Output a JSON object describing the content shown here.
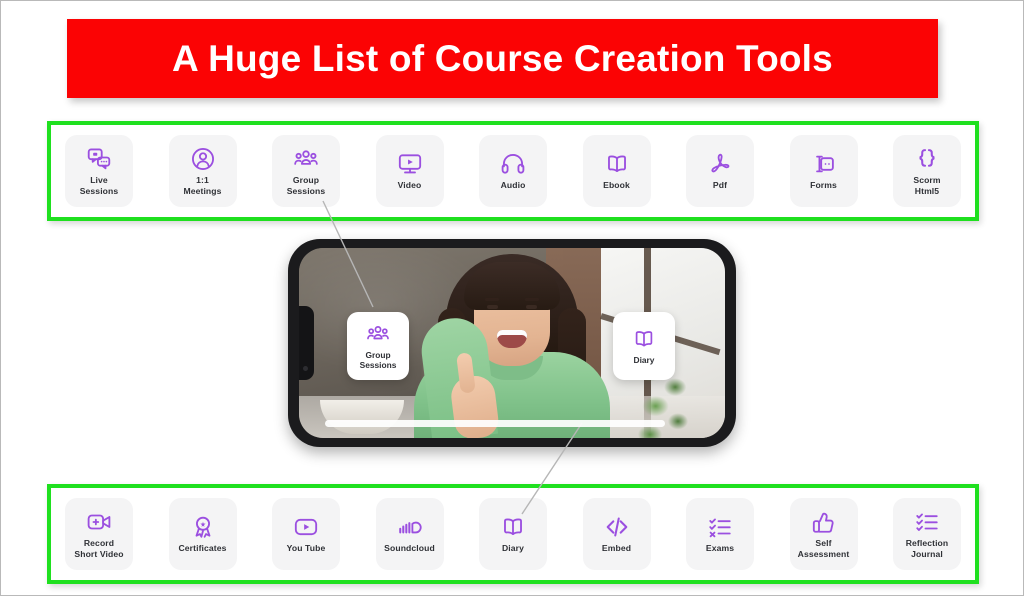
{
  "title": {
    "text": "A Huge List of Course Creation Tools",
    "banner_color": "#FB0304",
    "text_color": "#FFFFFF"
  },
  "theme": {
    "frame_green": "#1FE01F",
    "icon_purple": "#9B4FE0",
    "tile_bg": "#F4F4F5",
    "label_color": "#2F3136"
  },
  "top_row": {
    "items": [
      {
        "label": "Live\nSessions",
        "icon": "live-sessions-icon"
      },
      {
        "label": "1:1\nMeetings",
        "icon": "one-to-one-meetings-icon"
      },
      {
        "label": "Group\nSessions",
        "icon": "group-sessions-icon"
      },
      {
        "label": "Video",
        "icon": "video-icon"
      },
      {
        "label": "Audio",
        "icon": "audio-headphones-icon"
      },
      {
        "label": "Ebook",
        "icon": "ebook-open-book-icon"
      },
      {
        "label": "Pdf",
        "icon": "pdf-icon"
      },
      {
        "label": "Forms",
        "icon": "forms-input-icon"
      },
      {
        "label": "Scorm\nHtml5",
        "icon": "scorm-html5-braces-icon"
      }
    ]
  },
  "bottom_row": {
    "items": [
      {
        "label": "Record\nShort Video",
        "icon": "record-short-video-icon"
      },
      {
        "label": "Certificates",
        "icon": "certificate-award-icon"
      },
      {
        "label": "You Tube",
        "icon": "youtube-play-icon"
      },
      {
        "label": "Soundcloud",
        "icon": "soundcloud-icon"
      },
      {
        "label": "Diary",
        "icon": "diary-open-book-icon"
      },
      {
        "label": "Embed",
        "icon": "embed-code-icon"
      },
      {
        "label": "Exams",
        "icon": "exams-checklist-icon"
      },
      {
        "label": "Self\nAssessment",
        "icon": "thumbs-up-icon"
      },
      {
        "label": "Reflection\nJournal",
        "icon": "reflection-journal-checklist-icon"
      }
    ]
  },
  "phone": {
    "cards": [
      {
        "label": "Group\nSessions",
        "icon": "group-sessions-icon"
      },
      {
        "label": "Diary",
        "icon": "diary-open-book-icon"
      }
    ]
  }
}
